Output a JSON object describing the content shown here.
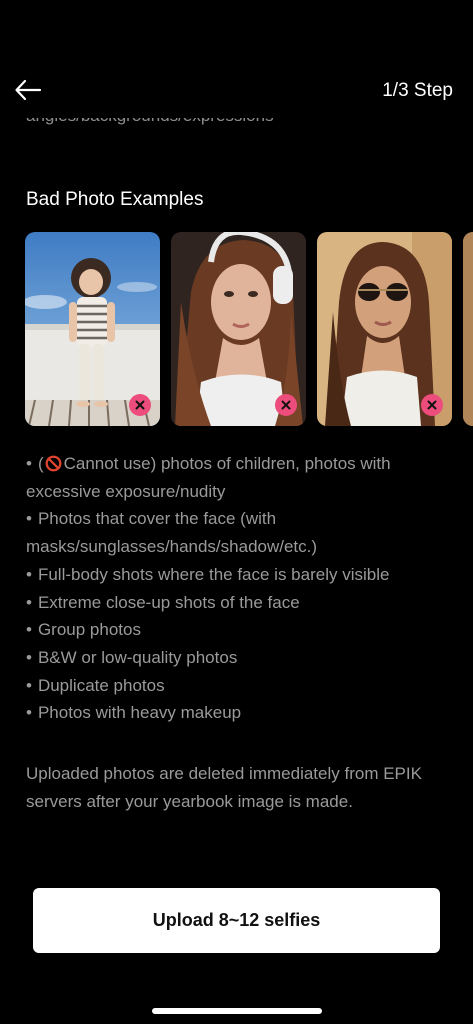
{
  "header": {
    "step_label": "1/3 Step"
  },
  "clipped_text": "angles/backgrounds/expressions",
  "section": {
    "title": "Bad Photo Examples"
  },
  "examples": [
    {
      "kind": "child"
    },
    {
      "kind": "headphones"
    },
    {
      "kind": "sunglasses"
    },
    {
      "kind": "partial"
    }
  ],
  "rules": {
    "line_1_pre": "(",
    "line_1_icon": "prohibited-icon",
    "line_1_text": "Cannot use) photos of children, photos with excessive exposure/nudity",
    "items": [
      "Photos that cover the face (with masks/sunglasses/hands/shadow/etc.)",
      "Full-body shots where the face is barely visible",
      "Extreme close-up shots of the face",
      "Group photos",
      "B&W or low-quality photos",
      "Duplicate photos",
      "Photos with heavy makeup"
    ],
    "bullet": "•"
  },
  "notice": "Uploaded photos are deleted immediately from EPIK servers after your yearbook image is made.",
  "upload_button": "Upload 8~12 selfies",
  "colors": {
    "background": "#000000",
    "muted_text": "#9a9a9a",
    "badge": "#ec4d7c",
    "button_bg": "#ffffff"
  }
}
